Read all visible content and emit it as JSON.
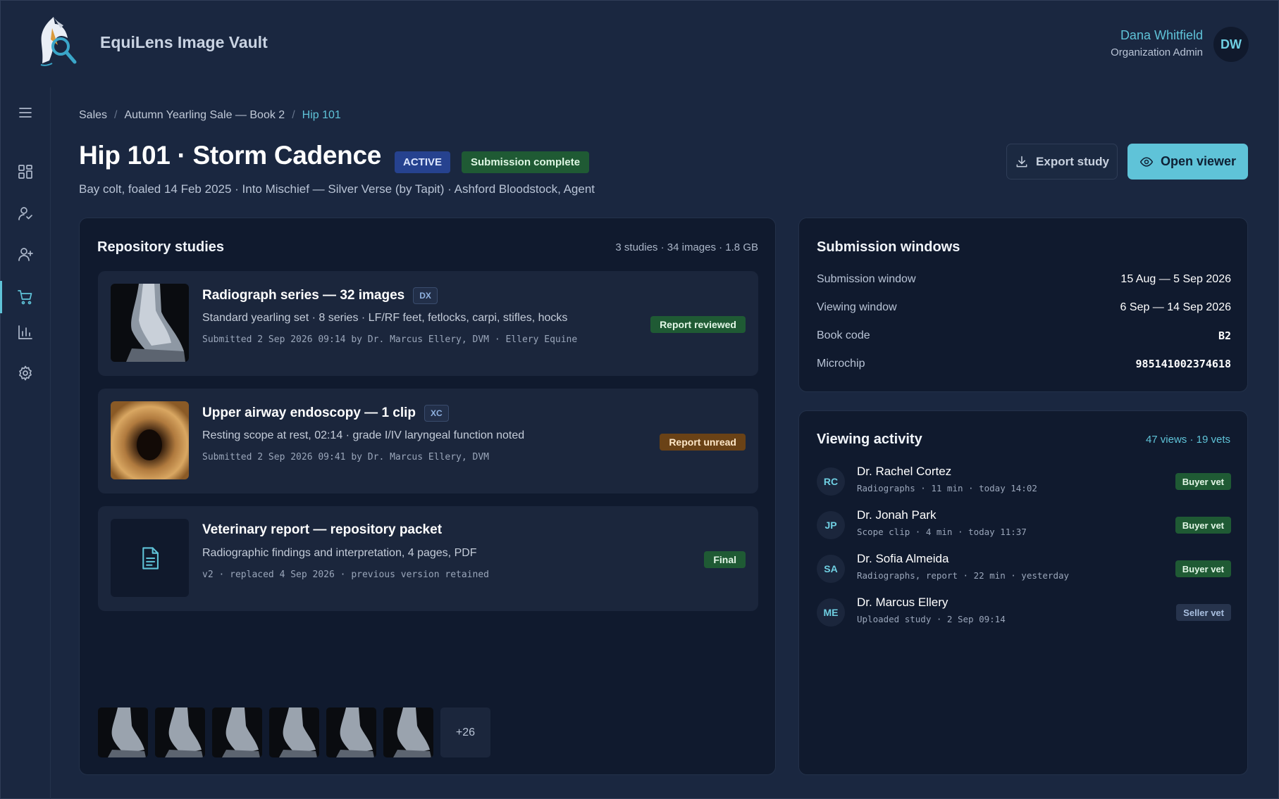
{
  "app": {
    "title": "EquiLens Image Vault"
  },
  "user": {
    "name": "Dana Whitfield",
    "role": "Organization Admin",
    "initials": "DW"
  },
  "sidebar": {
    "items": [
      {
        "icon": "menu-icon"
      },
      {
        "icon": "dashboard-icon"
      },
      {
        "icon": "user-check-icon"
      },
      {
        "icon": "user-plus-icon"
      },
      {
        "icon": "cart-icon",
        "active": true
      },
      {
        "icon": "bar-chart-icon"
      },
      {
        "icon": "gear-icon"
      }
    ]
  },
  "breadcrumb": {
    "items": [
      "Sales",
      "Autumn Yearling Sale — Book 2",
      "Hip 101"
    ],
    "separator": "/"
  },
  "page": {
    "title": "Hip 101 · Storm Cadence",
    "badges": {
      "active": "ACTIVE",
      "submission": "Submission complete"
    },
    "subtitle": "Bay colt, foaled 14 Feb 2025 · Into Mischief — Silver Verse (by Tapit) · Ashford Bloodstock, Agent"
  },
  "actions": {
    "export": "Export study",
    "open": "Open viewer"
  },
  "repository": {
    "title": "Repository studies",
    "summary": "3 studies · 34 images · 1.8 GB",
    "studies": [
      {
        "title": "Radiograph series — 32 images",
        "modality": "DX",
        "description": "Standard yearling set · 8 series · LF/RF feet, fetlocks, carpi, stifles, hocks",
        "submitted": "Submitted 2 Sep 2026 09:14 by Dr. Marcus Ellery, DVM · Ellery Equine",
        "status": "Report reviewed"
      },
      {
        "title": "Upper airway endoscopy — 1 clip",
        "modality": "XC",
        "description": "Resting scope at rest, 02:14 · grade I/IV laryngeal function noted",
        "submitted": "Submitted 2 Sep 2026 09:41 by Dr. Marcus Ellery, DVM",
        "status": "Report unread"
      },
      {
        "title": "Veterinary report — repository packet",
        "description": "Radiographic findings and interpretation, 4 pages, PDF",
        "submitted": "v2 · replaced 4 Sep 2026 · previous version retained",
        "status": "Final"
      }
    ],
    "more_count": "+26"
  },
  "windows": {
    "title": "Submission windows",
    "rows": [
      {
        "key": "Submission window",
        "value": "15 Aug — 5 Sep 2026"
      },
      {
        "key": "Viewing window",
        "value": "6 Sep — 14 Sep 2026"
      },
      {
        "key": "Book code",
        "value": "B2"
      },
      {
        "key": "Microchip",
        "value": "985141002374618"
      }
    ]
  },
  "activity": {
    "title": "Viewing activity",
    "summary": "47 views · 19 vets",
    "rows": [
      {
        "initials": "RC",
        "name": "Dr. Rachel Cortez",
        "detail": "Radiographs · 11 min · today 14:02",
        "role": "Buyer vet"
      },
      {
        "initials": "JP",
        "name": "Dr. Jonah Park",
        "detail": "Scope clip · 4 min · today 11:37",
        "role": "Buyer vet"
      },
      {
        "initials": "SA",
        "name": "Dr. Sofia Almeida",
        "detail": "Radiographs, report · 22 min · yesterday",
        "role": "Buyer vet"
      },
      {
        "initials": "ME",
        "name": "Dr. Marcus Ellery",
        "detail": "Uploaded study · 2 Sep 09:14",
        "role": "Seller vet"
      }
    ]
  },
  "colors": {
    "accent": "#5fc3d8",
    "background": "#1a2740",
    "panel": "#101a2e",
    "success": "#1f5a34",
    "warning": "#6a4216",
    "active": "#26428f"
  }
}
